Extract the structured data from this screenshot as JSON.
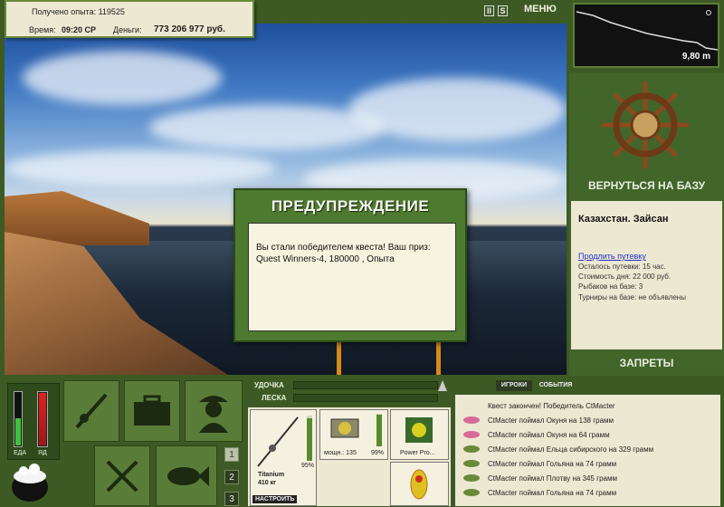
{
  "hud": {
    "experience_label": "Получено опыта: 119525",
    "time_label": "Время:",
    "time_value": "09:20 СР",
    "money_label": "Деньги:",
    "money_value": "773 206 977 руб."
  },
  "controls": {
    "pause": "II",
    "sound": "S",
    "menu": "МЕНЮ"
  },
  "depth": {
    "value": "9,80 m"
  },
  "right_panel": {
    "return_button": "ВЕРНУТЬСЯ НА БАЗУ",
    "location": "Казахстан. Зайсан",
    "extend_link": "Продлить путевку",
    "lines": [
      "Осталось путевки: 15 час.",
      "Стоимость дня: 22 000 руб.",
      "Рыбаков на базе: 3",
      "Турниры на базе: не объявлены"
    ],
    "bans_button": "ЗАПРЕТЫ"
  },
  "dialog": {
    "title": "ПРЕДУПРЕЖДЕНИЕ",
    "message": "Вы стали победителем квеста! Ваш приз: Quest Winners-4, 180000 , Опыта"
  },
  "bottom": {
    "food_label": "ЕДА",
    "poison_label": "ЯД",
    "rod_label": "УДОЧКА",
    "line_label": "ЛЕСКА",
    "pages": [
      "1",
      "2",
      "3"
    ],
    "active_page": "2",
    "gear": {
      "rod_percent": "95%",
      "rod_name": "Titanium",
      "rod_weight": "410 кг",
      "setup_button": "НАСТРОИТЬ",
      "reel_power": "мощн.: 135",
      "reel_percent": "99%",
      "line_name": "Power Pro..."
    }
  },
  "events": {
    "tab_players": "ИГРОКИ",
    "tab_events": "СОБЫТИЯ",
    "items": [
      "Квест закончен! Победитель CtMacter",
      "CtMacter поймал Окуня на 138 грамм",
      "CtMacter поймал Окуня на 64 грамм",
      "CtMacter поймал Ельца сибирского на 329 грамм",
      "CtMacter поймал Гольяна на 74 грамм",
      "CtMacter поймал Плотву на 345 грамм",
      "CtMacter поймал Гольяна на 74 грамм"
    ]
  }
}
